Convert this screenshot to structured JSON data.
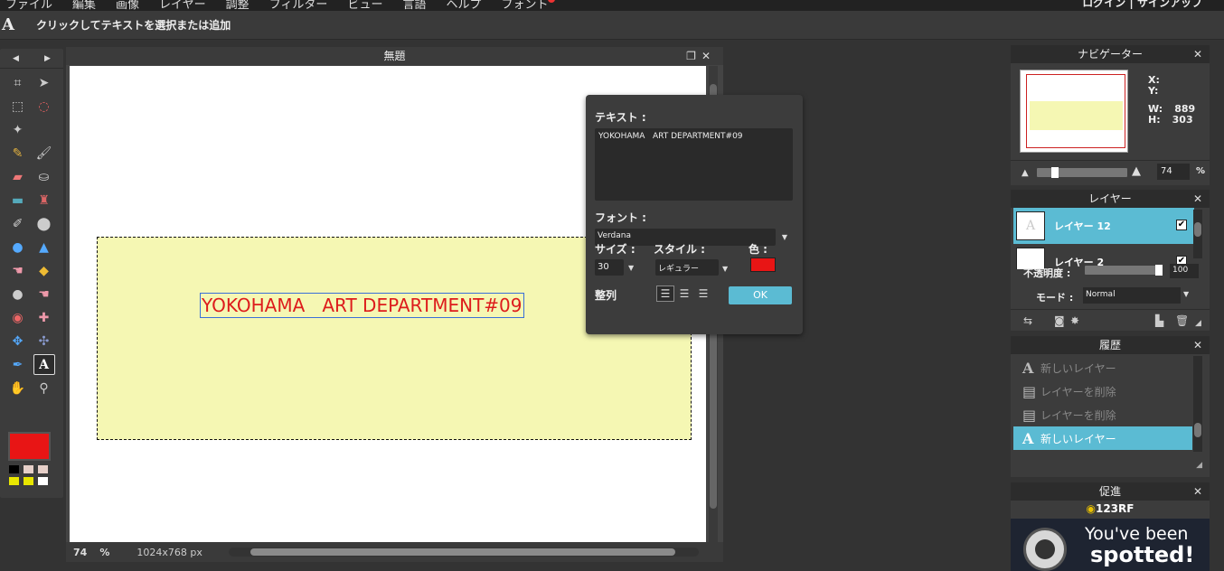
{
  "menu": {
    "items": [
      "ファイル",
      "編集",
      "画像",
      "レイヤー",
      "調整",
      "フィルター",
      "ビュー",
      "言語",
      "ヘルプ",
      "フォント"
    ],
    "auth": "ログイン | サインアップ"
  },
  "options_bar": {
    "tool_glyph": "A",
    "hint": "クリックしてテキストを選択または追加"
  },
  "document": {
    "title": "無題",
    "canvas_text": "YOKOHAMA   ART DEPARTMENT#09",
    "status": {
      "zoom": "74",
      "pct": "%",
      "dims": "1024x768 px"
    }
  },
  "text_dialog": {
    "text_label": "テキスト :",
    "text_value": "YOKOHAMA   ART DEPARTMENT#09",
    "font_label": "フォント :",
    "font_value": "Verdana",
    "size_label": "サイズ :",
    "size_value": "30",
    "style_label": "スタイル :",
    "style_value": "レギュラー",
    "color_label": "色 :",
    "color_value": "#e81515",
    "align_label": "整列",
    "ok_label": "OK"
  },
  "navigator": {
    "title": "ナビゲーター",
    "x_label": "X:",
    "y_label": "Y:",
    "w_label": "W:",
    "w_value": "889",
    "h_label": "H:",
    "h_value": "303",
    "zoom_value": "74",
    "zoom_unit": "%"
  },
  "layers": {
    "title": "レイヤー",
    "items": [
      {
        "name": "レイヤー 12",
        "glyph": "A"
      },
      {
        "name": "レイヤー 2",
        "glyph": ""
      }
    ],
    "opacity_label": "不透明度 :",
    "opacity_value": "100",
    "mode_label": "モード :",
    "mode_value": "Normal"
  },
  "history": {
    "title": "履歴",
    "items": [
      {
        "icon": "A",
        "label": "新しいレイヤー"
      },
      {
        "icon": "▤",
        "label": "レイヤーを削除"
      },
      {
        "icon": "▤",
        "label": "レイヤーを削除"
      },
      {
        "icon": "A",
        "label": "新しいレイヤー"
      }
    ]
  },
  "promo": {
    "title": "促進",
    "brand": "123RF",
    "line1": "You've been",
    "line2": "spotted!"
  },
  "colors": {
    "foreground": "#e81515",
    "accent": "#5bbbd3",
    "swatches": [
      "#000000",
      "#e6cfc8",
      "#e6cfc8",
      "#e8e600",
      "#e8e600",
      "#ffffff"
    ]
  }
}
